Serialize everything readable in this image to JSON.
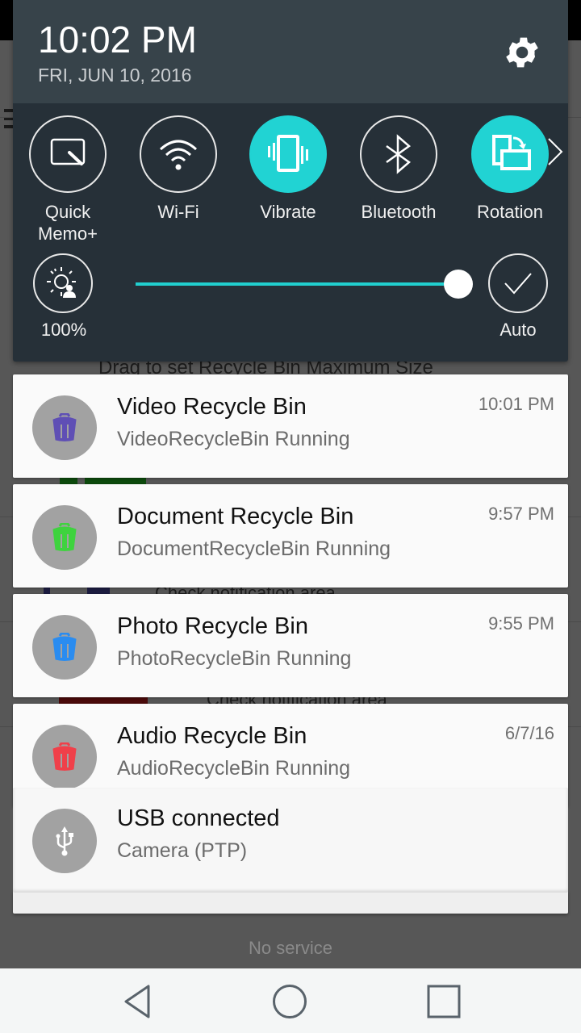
{
  "background_app": {
    "partial_text_1": "Drag to set Recycle Bin Maximum Size",
    "partial_text_2": "Check notification area",
    "partial_text_3": "Check notification area"
  },
  "shade": {
    "time": "10:02 PM",
    "date": "FRI, JUN 10, 2016",
    "settings_icon": "gear-icon",
    "quick_settings": [
      {
        "label": "Quick Memo+",
        "icon": "quick-memo-icon",
        "active": false
      },
      {
        "label": "Wi-Fi",
        "icon": "wifi-icon",
        "active": false
      },
      {
        "label": "Vibrate",
        "icon": "vibrate-icon",
        "active": true
      },
      {
        "label": "Bluetooth",
        "icon": "bluetooth-icon",
        "active": false
      },
      {
        "label": "Rotation",
        "icon": "rotation-icon",
        "active": true
      }
    ],
    "more_icon": "chevron-right-icon",
    "brightness": {
      "percent_label": "100%",
      "level": 1.0,
      "auto_label": "Auto",
      "auto_enabled": true
    },
    "accent_color": "#21d3d3"
  },
  "notifications": [
    {
      "title": "Video Recycle Bin",
      "subtitle": "VideoRecycleBin Running",
      "time": "10:01 PM",
      "icon_color": "#5f4fb5"
    },
    {
      "title": "Document Recycle Bin",
      "subtitle": "DocumentRecycleBin Running",
      "time": "9:57 PM",
      "icon_color": "#3ed33e"
    },
    {
      "title": "Photo Recycle Bin",
      "subtitle": "PhotoRecycleBin Running",
      "time": "9:55 PM",
      "icon_color": "#2a8cf0"
    },
    {
      "title": "Audio Recycle Bin",
      "subtitle": "AudioRecycleBin Running",
      "time": "6/7/16",
      "icon_color": "#f0404a"
    },
    {
      "title": "USB connected",
      "subtitle": "Camera (PTP)",
      "time": "",
      "icon_color": "#ffffff"
    }
  ],
  "carrier_status": "No service",
  "navbar": {
    "back": "back-icon",
    "home": "home-icon",
    "recents": "recents-icon"
  }
}
